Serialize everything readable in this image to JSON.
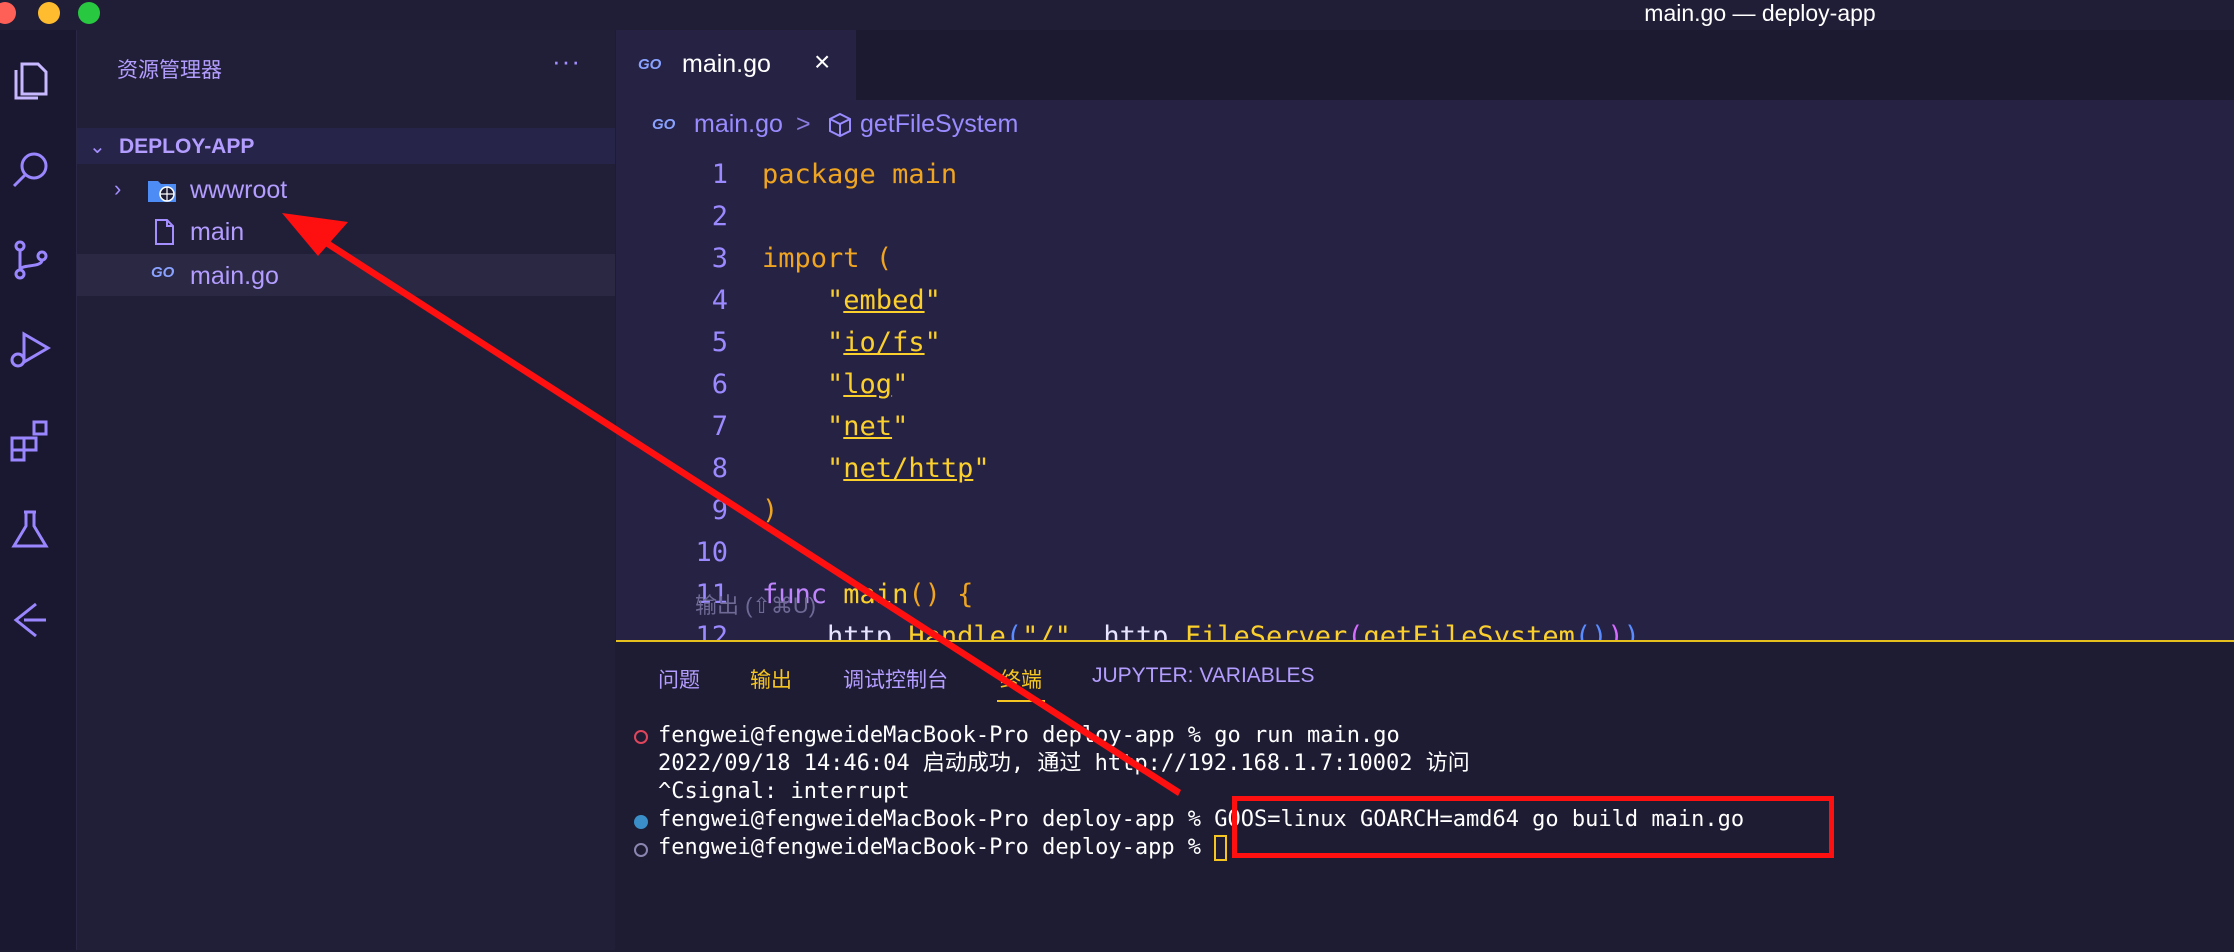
{
  "window": {
    "title": "main.go — deploy-app"
  },
  "activity_bar": {
    "icons": [
      "explorer-icon",
      "search-icon",
      "source-control-icon",
      "run-debug-icon",
      "extensions-icon",
      "testing-icon",
      "remote-icon"
    ]
  },
  "sidebar": {
    "title": "资源管理器",
    "more": "···",
    "folder": "DEPLOY-APP",
    "items": [
      {
        "label": "wwwroot",
        "kind": "folder"
      },
      {
        "label": "main",
        "kind": "file"
      },
      {
        "label": "main.go",
        "kind": "go"
      }
    ]
  },
  "editor": {
    "tab": {
      "label": "main.go",
      "icon_text": "GO",
      "close": "×"
    },
    "breadcrumb": {
      "icon_text": "GO",
      "file": "main.go",
      "separator": ">",
      "symbol": "getFileSystem"
    },
    "lines": [
      {
        "n": "1",
        "tokens": [
          [
            "kw",
            "package"
          ],
          [
            "plain",
            " "
          ],
          [
            "kw",
            "main"
          ]
        ]
      },
      {
        "n": "2",
        "tokens": []
      },
      {
        "n": "3",
        "tokens": [
          [
            "kw",
            "import"
          ],
          [
            "plain",
            " "
          ],
          [
            "kw",
            "("
          ]
        ]
      },
      {
        "n": "4",
        "tokens": [
          [
            "plain",
            "    "
          ],
          [
            "str",
            "\""
          ],
          [
            "strul",
            "embed"
          ],
          [
            "str",
            "\""
          ]
        ]
      },
      {
        "n": "5",
        "tokens": [
          [
            "plain",
            "    "
          ],
          [
            "str",
            "\""
          ],
          [
            "strul",
            "io/fs"
          ],
          [
            "str",
            "\""
          ]
        ]
      },
      {
        "n": "6",
        "tokens": [
          [
            "plain",
            "    "
          ],
          [
            "str",
            "\""
          ],
          [
            "strul",
            "log"
          ],
          [
            "str",
            "\""
          ]
        ]
      },
      {
        "n": "7",
        "tokens": [
          [
            "plain",
            "    "
          ],
          [
            "str",
            "\""
          ],
          [
            "strul",
            "net"
          ],
          [
            "str",
            "\""
          ]
        ]
      },
      {
        "n": "8",
        "tokens": [
          [
            "plain",
            "    "
          ],
          [
            "str",
            "\""
          ],
          [
            "strul",
            "net/http"
          ],
          [
            "str",
            "\""
          ]
        ]
      },
      {
        "n": "9",
        "tokens": [
          [
            "kw",
            ")"
          ]
        ]
      },
      {
        "n": "10",
        "tokens": []
      },
      {
        "n": "11",
        "tokens": [
          [
            "kw2",
            "func"
          ],
          [
            "plain",
            " "
          ],
          [
            "fn",
            "main"
          ],
          [
            "kw",
            "() {"
          ]
        ]
      },
      {
        "n": "12",
        "tokens": [
          [
            "plain",
            "    http."
          ],
          [
            "fn",
            "Handle"
          ],
          [
            "paren",
            "("
          ],
          [
            "str",
            "\"/\""
          ],
          [
            "plain",
            ", http."
          ],
          [
            "fn",
            "FileServer"
          ],
          [
            "paren2",
            "("
          ],
          [
            "fn",
            "getFileSystem"
          ],
          [
            "paren",
            "()"
          ],
          [
            "paren2",
            ")"
          ],
          [
            "paren",
            ")"
          ]
        ]
      }
    ],
    "tooltip": "输出 (⇧⌘U)"
  },
  "panel": {
    "tabs": [
      "问题",
      "输出",
      "调试控制台",
      "终端",
      "JUPYTER: VARIABLES"
    ],
    "active_tab": "终端",
    "terminal": [
      {
        "marker": "error",
        "text": "fengwei@fengweideMacBook-Pro deploy-app % go run main.go"
      },
      {
        "marker": "none",
        "text": "2022/09/18 14:46:04 启动成功, 通过 http://192.168.1.7:10002 访问"
      },
      {
        "marker": "none",
        "text": "^Csignal: interrupt"
      },
      {
        "marker": "filled",
        "text": "fengwei@fengweideMacBook-Pro deploy-app % GOOS=linux GOARCH=amd64 go build main.go"
      },
      {
        "marker": "hollow",
        "text": "fengwei@fengweideMacBook-Pro deploy-app % "
      }
    ]
  },
  "colors": {
    "annotation": "#ff1010",
    "accent": "#f5c521",
    "sidebar_text": "#b39dff"
  }
}
